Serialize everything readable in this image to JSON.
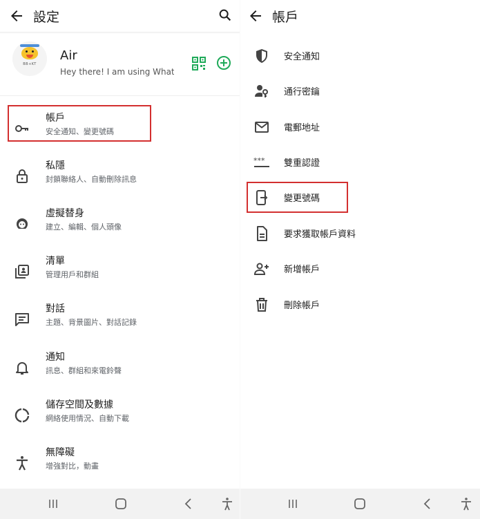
{
  "colors": {
    "accent_green": "#1faa59",
    "highlight_red": "#d32f2f",
    "text_secondary": "#5f6368"
  },
  "left": {
    "title": "設定",
    "profile": {
      "name": "Air",
      "status": "Hey there! I am using What…",
      "avatar_badge": "BB+KT"
    },
    "items": [
      {
        "label": "帳戶",
        "sub": "安全通知、變更號碼",
        "icon": "key-icon"
      },
      {
        "label": "私隱",
        "sub": "封鎖聯絡人、自動刪除訊息",
        "icon": "lock-icon"
      },
      {
        "label": "虛擬替身",
        "sub": "建立、編輯、個人頭像",
        "icon": "avatar-face-icon"
      },
      {
        "label": "清單",
        "sub": "管理用戶和群組",
        "icon": "contact-list-icon"
      },
      {
        "label": "對話",
        "sub": "主題、背景圖片、對話記錄",
        "icon": "chat-icon"
      },
      {
        "label": "通知",
        "sub": "訊息、群組和來電鈴聲",
        "icon": "bell-icon"
      },
      {
        "label": "儲存空間及數據",
        "sub": "網絡使用情況、自動下載",
        "icon": "data-usage-icon"
      },
      {
        "label": "無障礙",
        "sub": "增強對比，動畫",
        "icon": "accessibility-icon"
      }
    ]
  },
  "right": {
    "title": "帳戶",
    "items": [
      {
        "label": "安全通知",
        "icon": "shield-icon"
      },
      {
        "label": "通行密鑰",
        "icon": "passkey-icon"
      },
      {
        "label": "電郵地址",
        "icon": "mail-icon"
      },
      {
        "label": "雙重認證",
        "icon": "password-dots-icon"
      },
      {
        "label": "變更號碼",
        "icon": "change-number-icon"
      },
      {
        "label": "要求獲取帳戶資料",
        "icon": "document-icon"
      },
      {
        "label": "新增帳戶",
        "icon": "add-person-icon"
      },
      {
        "label": "刪除帳戶",
        "icon": "trash-icon"
      }
    ]
  }
}
